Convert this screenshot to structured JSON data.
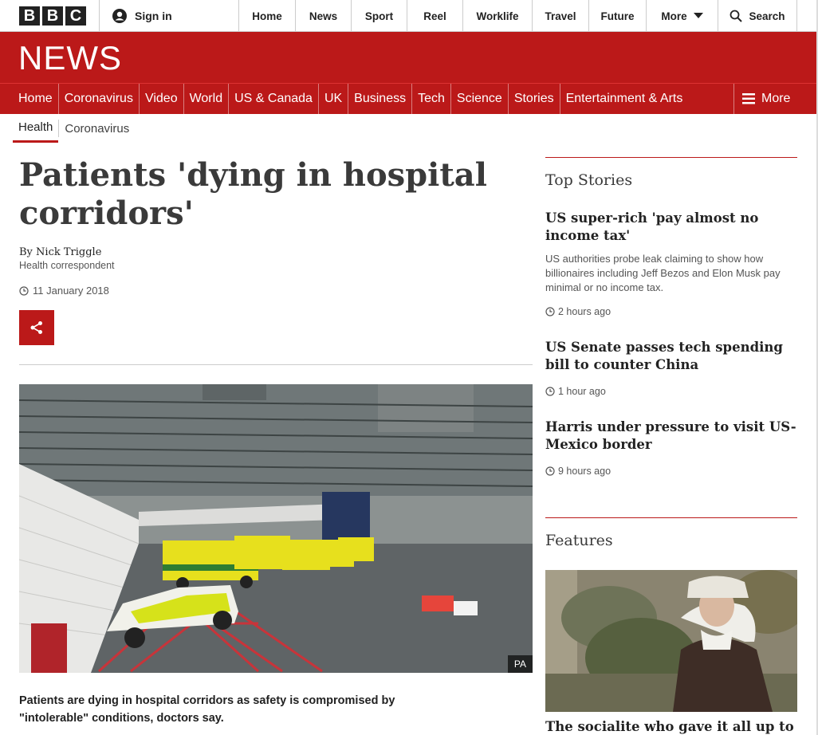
{
  "bbc": {
    "logo_letters": [
      "B",
      "B",
      "C"
    ],
    "sign_in": "Sign in"
  },
  "topnav": {
    "items": [
      "Home",
      "News",
      "Sport",
      "Reel",
      "Worklife",
      "Travel",
      "Future",
      "More"
    ],
    "search": "Search"
  },
  "banner": {
    "brand": "NEWS",
    "color": "#bb1919"
  },
  "secnav": {
    "items": [
      "Home",
      "Coronavirus",
      "Video",
      "World",
      "US & Canada",
      "UK",
      "Business",
      "Tech",
      "Science",
      "Stories",
      "Entertainment & Arts"
    ],
    "more": "More"
  },
  "subnav": {
    "items": [
      "Health",
      "Coronavirus"
    ]
  },
  "article": {
    "headline": "Patients 'dying in hospital corridors'",
    "byline": "By Nick Triggle",
    "role": "Health correspondent",
    "date": "11 January 2018",
    "image_credit": "PA",
    "summary": "Patients are dying in hospital corridors as safety is compromised by \"intolerable\" conditions, doctors say."
  },
  "sidebar": {
    "top_stories_title": "Top Stories",
    "stories": [
      {
        "title": "US super-rich 'pay almost no income tax'",
        "desc": "US authorities probe leak claiming to show how billionaires including Jeff Bezos and Elon Musk pay minimal or no income tax.",
        "time": "2 hours ago"
      },
      {
        "title": "US Senate passes tech spending bill to counter China",
        "time": "1 hour ago"
      },
      {
        "title": "Harris under pressure to visit US-Mexico border",
        "time": "9 hours ago"
      }
    ],
    "features_title": "Features",
    "feature": {
      "title": "The socialite who gave it all up to"
    }
  }
}
